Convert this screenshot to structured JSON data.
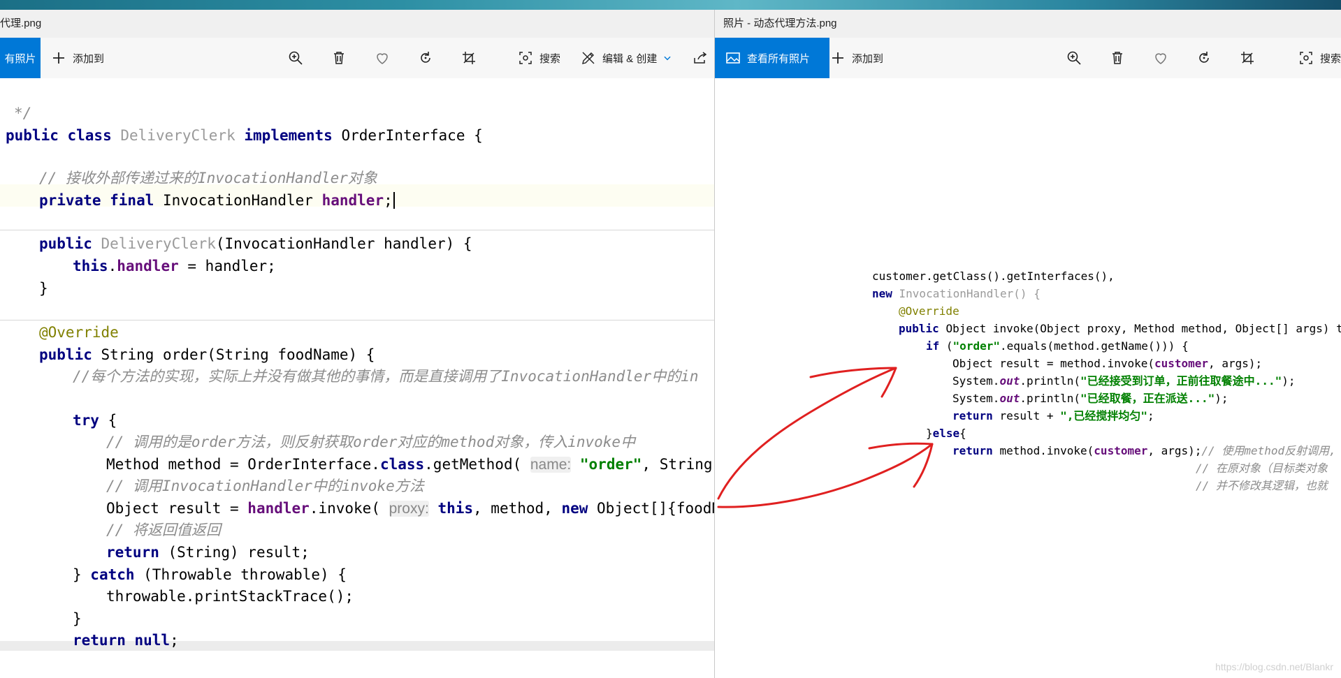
{
  "colors": {
    "accent": "#0078d7",
    "keyword": "#000080",
    "comment": "#8c8c8c",
    "annotation": "#808000",
    "string": "#008000",
    "arrow": "#e02020"
  },
  "left": {
    "title": "代理.png",
    "toolbar": {
      "view_all": "有照片",
      "add_to": "添加到",
      "search": "搜索",
      "edit_create": "编辑 & 创建",
      "icons": [
        "zoom-in-icon",
        "delete-icon",
        "heart-icon",
        "rotate-icon",
        "crop-icon",
        "search-icon",
        "edit-icon",
        "chevron-down-icon",
        "share-icon"
      ]
    },
    "code": {
      "l0": "*/",
      "l1_kw1": "public class ",
      "l1_name": "DeliveryClerk ",
      "l1_kw2": "implements ",
      "l1_rest": "OrderInterface {",
      "l2": "// 接收外部传递过来的InvocationHandler对象",
      "l3_kw": "private final ",
      "l3_type": "InvocationHandler ",
      "l3_fld": "handler",
      "l3_end": ";",
      "l4_kw": "public ",
      "l4_name": "DeliveryClerk",
      "l4_rest": "(InvocationHandler handler) {",
      "l5_kw": "this",
      "l5_dot": ".",
      "l5_fld": "handler",
      "l5_rest": " = handler;",
      "l6": "}",
      "l7": "@Override",
      "l8_kw": "public ",
      "l8_rest": "String order(String foodName) {",
      "l9": "//每个方法的实现，实际上并没有做其他的事情，而是直接调用了InvocationHandler中的in",
      "l10_kw": "try ",
      "l10_rest": "{",
      "l11": "// 调用的是order方法，则反射获取order对应的method对象，传入invoke中",
      "l12_a": "Method method = OrderInterface.",
      "l12_kw": "class",
      "l12_b": ".getMethod( ",
      "l12_hint": "name:",
      "l12_str": " \"order\"",
      "l12_c": ", String.cla",
      "l13": "// 调用InvocationHandler中的invoke方法",
      "l14_a": "Object result = ",
      "l14_fld": "handler",
      "l14_b": ".invoke( ",
      "l14_hint": "proxy:",
      "l14_kw": " this",
      "l14_c": ", method, ",
      "l14_kw2": "new ",
      "l14_d": "Object[]{foodName",
      "l15": "// 将返回值返回",
      "l16_kw": "return ",
      "l16_rest": "(String) result;",
      "l17_a": "} ",
      "l17_kw": "catch ",
      "l17_rest": "(Throwable throwable) {",
      "l18": "throwable.printStackTrace();",
      "l19": "}",
      "l20_kw": "return null",
      "l20_rest": ";"
    }
  },
  "right": {
    "title": "照片 - 动态代理方法.png",
    "toolbar": {
      "view_all": "查看所有照片",
      "add_to": "添加到",
      "search": "搜索",
      "icons": [
        "image-icon",
        "plus-icon",
        "zoom-in-icon",
        "delete-icon",
        "heart-icon",
        "rotate-icon",
        "crop-icon",
        "search-icon"
      ]
    },
    "code": {
      "r1": "customer.getClass().getInterfaces(),",
      "r2_kw": "new ",
      "r2_rest": "InvocationHandler() {",
      "r3": "@Override",
      "r4_kw": "public ",
      "r4_rest": "Object invoke(Object proxy, Method method, Object[] args) t",
      "r5_kw": "if ",
      "r5_a": "(",
      "r5_str": "\"order\"",
      "r5_b": ".equals(method.getName())) {",
      "r6_a": "Object result = method.invoke(",
      "r6_fld": "customer",
      "r6_b": ", args);",
      "r7_a": "System.",
      "r7_it": "out",
      "r7_b": ".println(",
      "r7_str": "\"已经接受到订单，正前往取餐途中...\"",
      "r7_c": ");",
      "r8_a": "System.",
      "r8_it": "out",
      "r8_b": ".println(",
      "r8_str": "\"已经取餐，正在派送...\"",
      "r8_c": ");",
      "r9_kw": "return ",
      "r9_a": "result + ",
      "r9_str": "\",已经搅拌均匀\"",
      "r9_b": ";",
      "r10_a": "}",
      "r10_kw": "else",
      "r10_b": "{",
      "r11_kw": "return ",
      "r11_a": "method.invoke(",
      "r11_fld": "customer",
      "r11_b": ", args);",
      "r11_cm": "// 使用method反射调用,",
      "r12": "// 在原对象（目标类对象",
      "r13": "// 并不修改其逻辑，也就"
    },
    "watermark": "https://blog.csdn.net/Blankr"
  }
}
